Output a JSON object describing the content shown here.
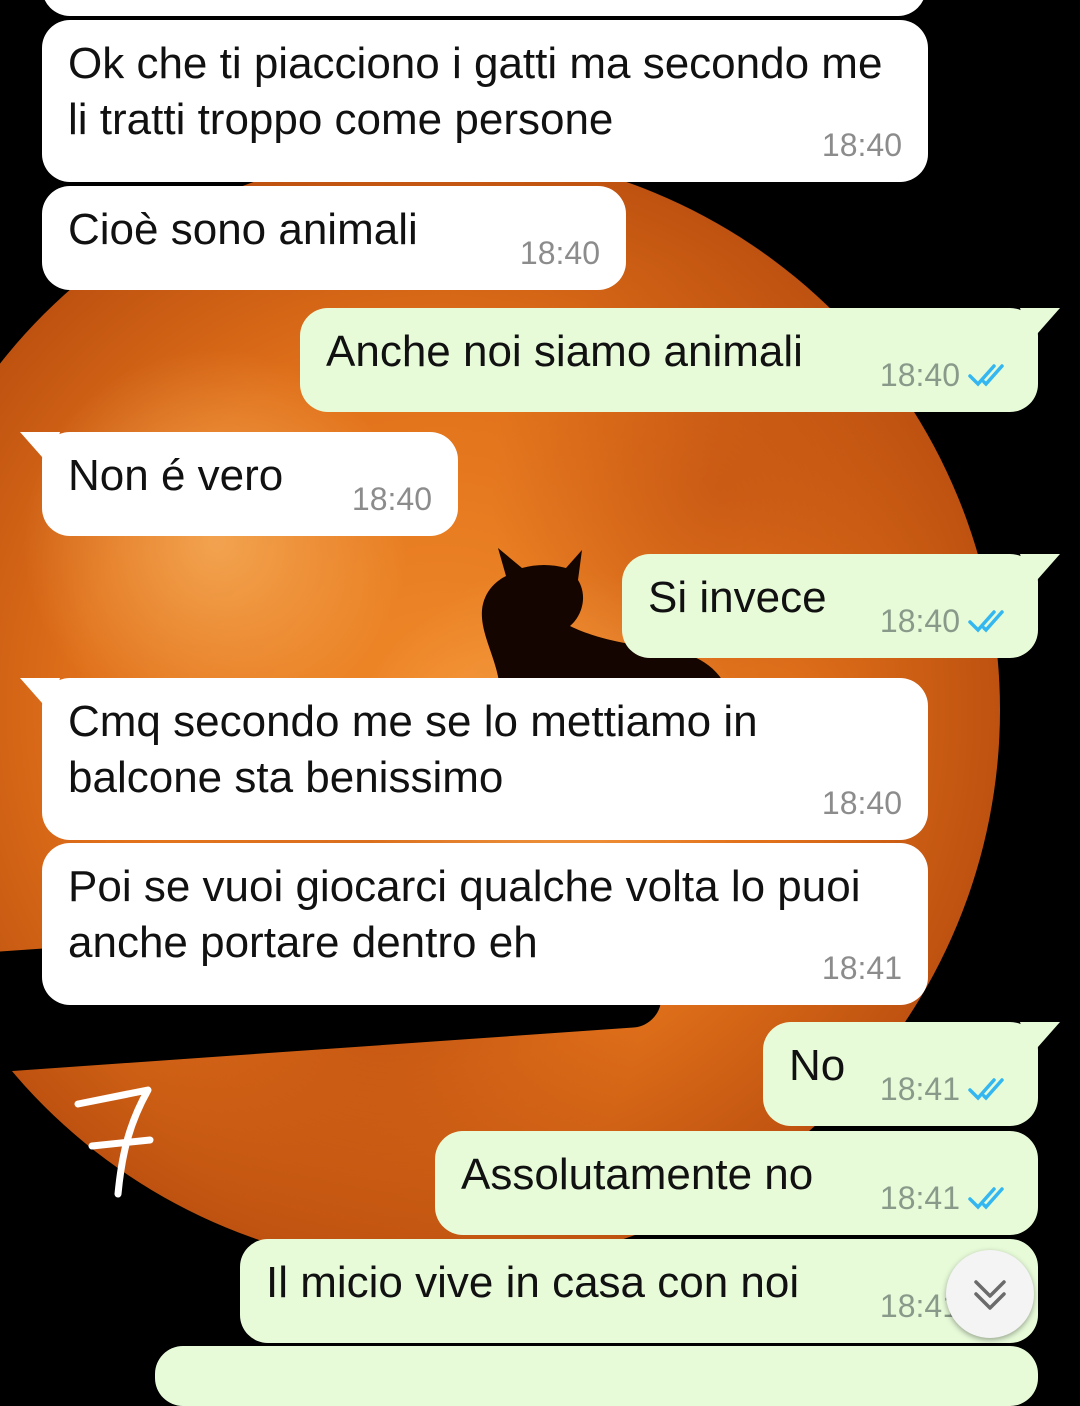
{
  "messages": [
    {
      "dir": "in",
      "text": "Ok che ti piacciono i gatti ma secondo me li tratti troppo come persone",
      "time": "18:40"
    },
    {
      "dir": "in",
      "text": "Cioè sono animali",
      "time": "18:40"
    },
    {
      "dir": "out",
      "text": "Anche noi siamo animali",
      "time": "18:40",
      "status": "read"
    },
    {
      "dir": "in",
      "text": "Non é vero",
      "time": "18:40"
    },
    {
      "dir": "out",
      "text": "Si invece",
      "time": "18:40",
      "status": "read"
    },
    {
      "dir": "in",
      "text": "Cmq secondo me se lo mettiamo in balcone sta benissimo",
      "time": "18:40"
    },
    {
      "dir": "in",
      "text": "Poi se vuoi giocarci qualche volta lo puoi anche portare dentro eh",
      "time": "18:41"
    },
    {
      "dir": "out",
      "text": "No",
      "time": "18:41",
      "status": "read"
    },
    {
      "dir": "out",
      "text": "Assolutamente no",
      "time": "18:41",
      "status": "read"
    },
    {
      "dir": "out",
      "text": "Il micio vive in casa con noi",
      "time": "18:41",
      "status": "read"
    }
  ],
  "wallpaper": {
    "moon_color": "#e0701a",
    "handwritten_mark": "7"
  },
  "colors": {
    "incoming_bubble": "#ffffff",
    "outgoing_bubble": "#e7fbd9",
    "read_ticks": "#34b7f1"
  },
  "scroll_button": {
    "icon": "double-chevron-down-icon"
  }
}
